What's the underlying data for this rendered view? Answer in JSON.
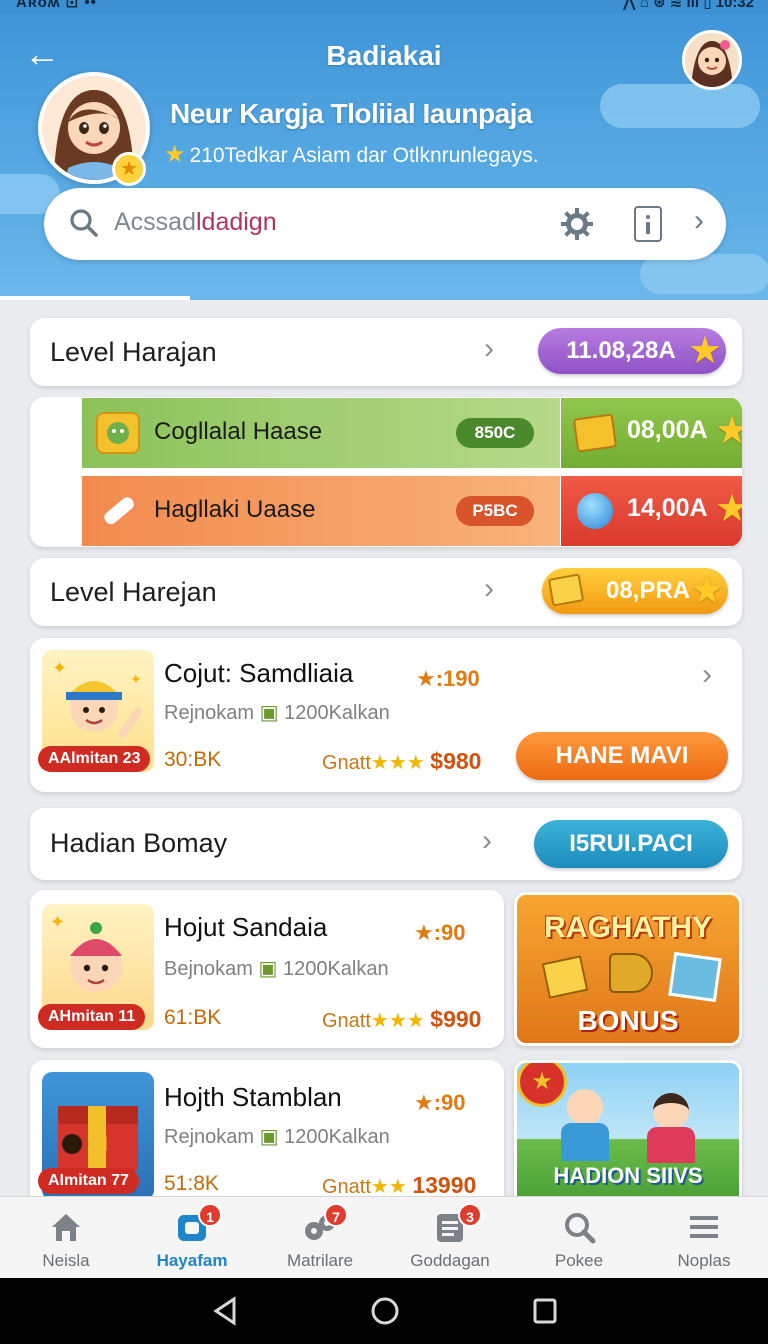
{
  "status_bar": {
    "left": "Aʀoʍ ⊡  ••",
    "right": "⋀ ⌂ ⊛ ≋ ıll ▯ 10:32"
  },
  "header": {
    "title": "Badiakai",
    "profile_name": "Neur Kargja Tloliial Iaunpaja",
    "profile_subtitle": "210Tedkar Asiam dar Otlknrunlegays.",
    "search_placeholder_a": "Acssad",
    "search_placeholder_b": "ldadign"
  },
  "rows": {
    "level1": {
      "title": "Level Harajan",
      "value": "11.08,28A"
    },
    "strip1": {
      "title": "Cogllalal Haase",
      "tag": "850C",
      "value": "08,00A"
    },
    "strip2": {
      "title": "Hagllaki Uaase",
      "tag": "P5BC",
      "value": "14,00A"
    },
    "level2": {
      "title": "Level Harejan",
      "value": "08,PRA"
    },
    "hadian": {
      "title": "Hadian Bomay",
      "button": "I5RUI.PACI"
    }
  },
  "games": [
    {
      "title": "Cojut: Samdliaia",
      "rating": "★:190",
      "meta_a": "Rejnokam",
      "meta_b": "1200Kalkan",
      "score": "30:BK",
      "grant_label": "Gnatt",
      "grant_value": "$980",
      "badge": "AAlmitan 23",
      "button": "HANE MAVI"
    },
    {
      "title": "Hojut Sandaia",
      "rating": "★:90",
      "meta_a": "Bejnokam",
      "meta_b": "1200Kalkan",
      "score": "61:BK",
      "grant_label": "Gnatt",
      "grant_value": "$990",
      "badge": "AHmitan 11"
    },
    {
      "title": "Hojth Stamblan",
      "rating": "★:90",
      "meta_a": "Rejnokam",
      "meta_b": "1200Kalkan",
      "score": "51:8K",
      "grant_label": "Gnatt",
      "grant_value": "13990",
      "badge": "AImitan 77"
    }
  ],
  "tiles": {
    "bonus_title": "RAGHATHY",
    "bonus_label": "BONUS",
    "hadion": "HADION SIIVS"
  },
  "nav": [
    {
      "label": "Neisla",
      "badge": ""
    },
    {
      "label": "Hayafam",
      "badge": "1"
    },
    {
      "label": "Matrilare",
      "badge": "7"
    },
    {
      "label": "Goddagan",
      "badge": "3"
    },
    {
      "label": "Pokee",
      "badge": ""
    },
    {
      "label": "Noplas",
      "badge": ""
    }
  ],
  "colors": {
    "accent": "#1f85c8",
    "header": "#3f95d8",
    "orange": "#f07a1a"
  }
}
